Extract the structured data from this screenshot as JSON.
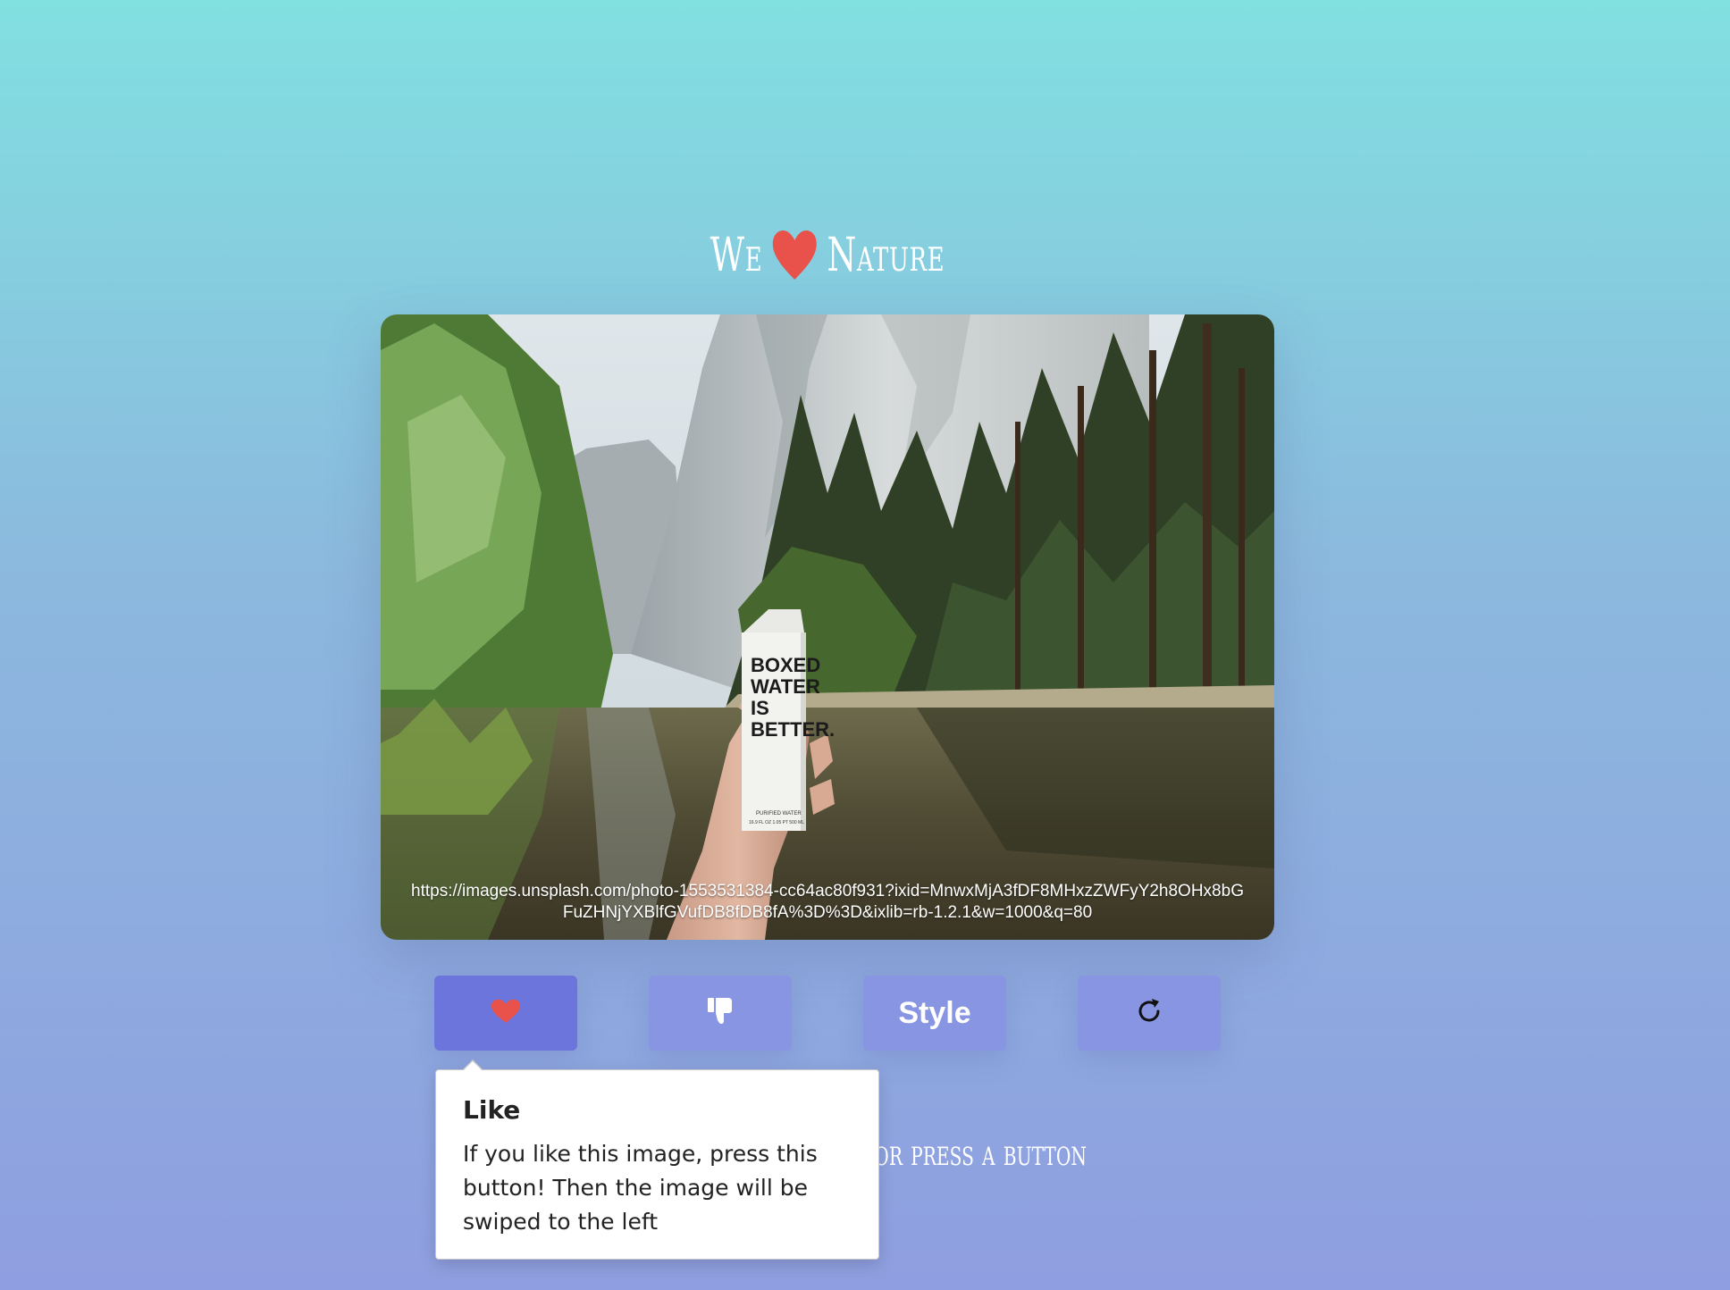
{
  "title": {
    "left_word": "We",
    "right_word": "Nature",
    "heart_icon": "heart-icon",
    "heart_color": "#e8524a"
  },
  "photo": {
    "url": "https://images.unsplash.com/photo-1553531384-cc64ac80f931?ixid=MnwxMjA3fDF8MHxzZWFyY2h8OHx8bGFuZHNjYXBlfGVufDB8fDB8fA%3D%3D&ixlib=rb-1.2.1&w=1000&q=80",
    "carton_lines": [
      "BOXED",
      "WATER",
      "IS",
      "BETTER."
    ],
    "carton_small_1": "PURIFIED WATER",
    "carton_small_2": "16.9 FL OZ  1.05 PT  500 ML"
  },
  "buttons": {
    "like_icon": "heart-icon",
    "dislike_icon": "thumbs-down-icon",
    "style_label": "Style",
    "reload_icon": "refresh-icon",
    "active_color": "#6b75dc",
    "button_color": "#8795e3"
  },
  "hint": {
    "visible_text": ", or press a button"
  },
  "tooltip": {
    "title": "Like",
    "body": "If you like this image, press this button! Then the image will be swiped to the left"
  }
}
